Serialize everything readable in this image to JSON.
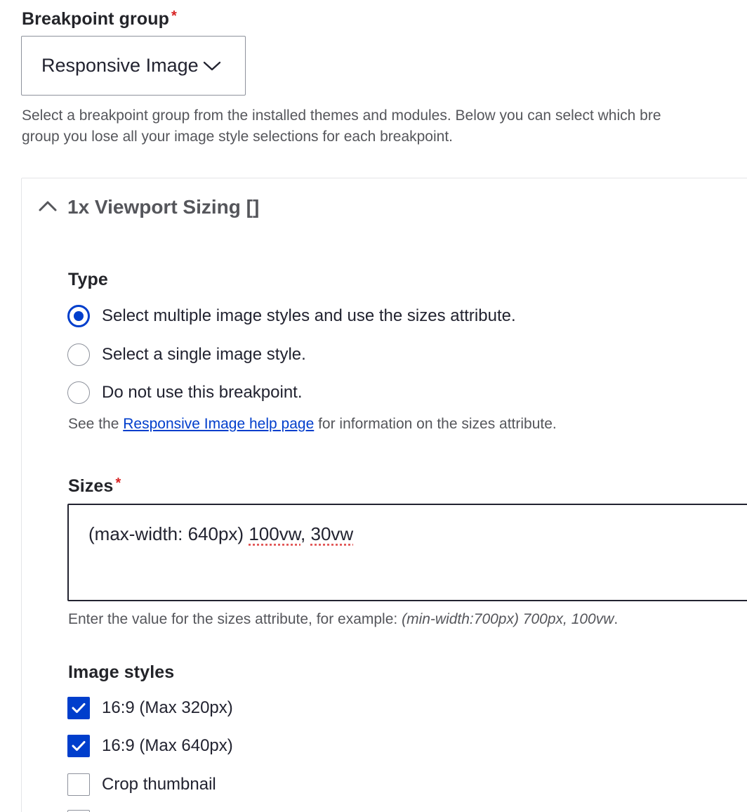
{
  "breakpoint_group": {
    "label": "Breakpoint group",
    "required_marker": "*",
    "selected_value": "Responsive Image",
    "description": "Select a breakpoint group from the installed themes and modules. Below you can select which bre",
    "description_line2": "group you lose all your image style selections for each breakpoint."
  },
  "details": {
    "summary": "1x Viewport Sizing []",
    "expanded": true
  },
  "type": {
    "label": "Type",
    "options": [
      {
        "label": "Select multiple image styles and use the sizes attribute.",
        "checked": true
      },
      {
        "label": "Select a single image style.",
        "checked": false
      },
      {
        "label": "Do not use this breakpoint.",
        "checked": false
      }
    ],
    "help_prefix": "See the ",
    "help_link": "Responsive Image help page",
    "help_suffix": " for information on the sizes attribute."
  },
  "sizes": {
    "label": "Sizes",
    "required_marker": "*",
    "value_prefix": "(max-width: 640px) ",
    "value_word1": "100vw",
    "value_sep": ", ",
    "value_word2": "30vw",
    "help_prefix": "Enter the value for the sizes attribute, for example: ",
    "help_example": "(min-width:700px) 700px, 100vw",
    "help_suffix": "."
  },
  "image_styles": {
    "label": "Image styles",
    "options": [
      {
        "label": "16:9 (Max 320px)",
        "checked": true
      },
      {
        "label": "16:9 (Max 640px)",
        "checked": true
      },
      {
        "label": "Crop thumbnail",
        "checked": false
      },
      {
        "label": "",
        "checked": false
      }
    ]
  },
  "colors": {
    "accent": "#003ecc",
    "required": "#d72222",
    "text": "#222330",
    "muted": "#55565b",
    "border": "#8e929c"
  },
  "icons": {
    "select_chevron": "chevron-down-icon",
    "details_toggle": "chevron-up-icon",
    "checkmark": "checkmark-icon"
  }
}
